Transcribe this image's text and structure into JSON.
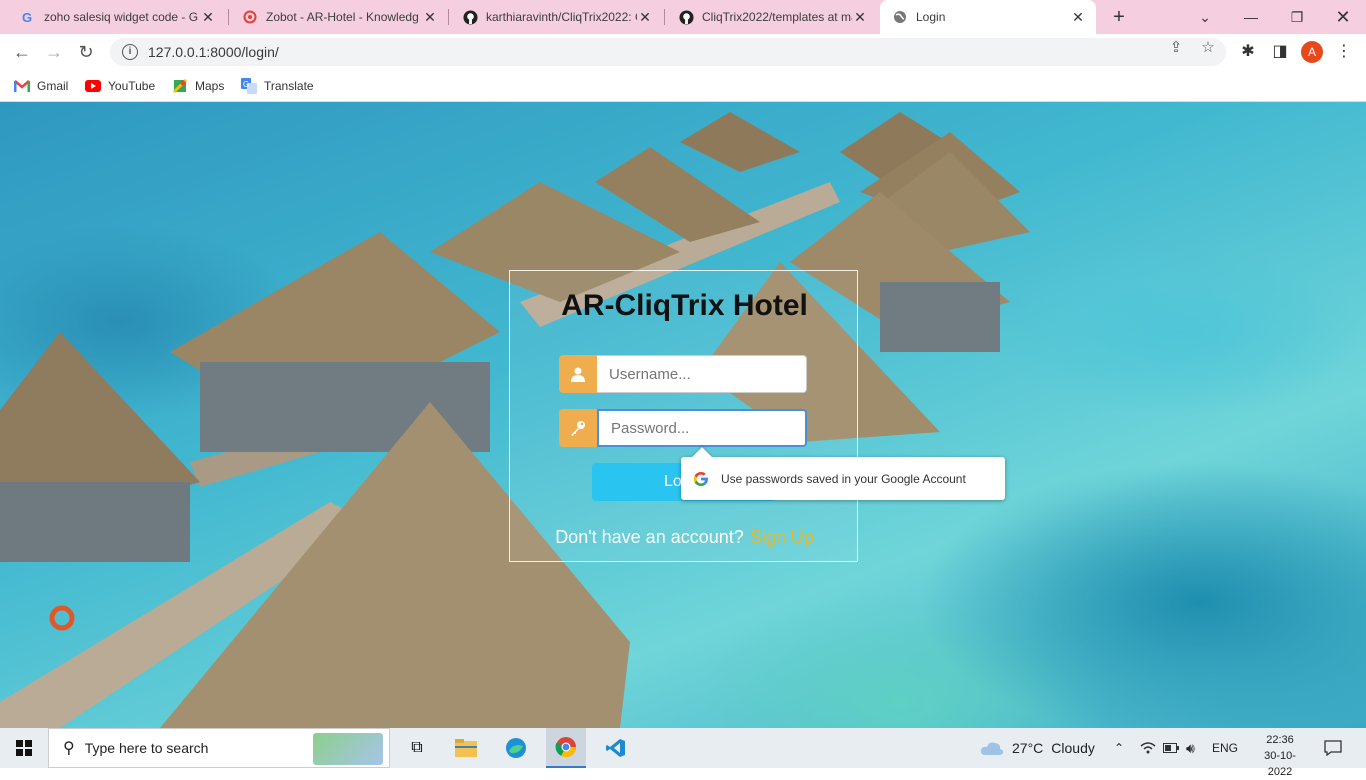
{
  "browser": {
    "tabs": [
      {
        "title": "zoho salesiq widget code - G",
        "favicon": "google-icon"
      },
      {
        "title": "Zobot - AR-Hotel - Knowledg",
        "favicon": "zobot-icon"
      },
      {
        "title": "karthiaravinth/CliqTrix2022: C",
        "favicon": "github-icon"
      },
      {
        "title": "CliqTrix2022/templates at ma",
        "favicon": "github-icon"
      },
      {
        "title": "Login",
        "favicon": "globe-icon",
        "active": true
      }
    ],
    "url": "127.0.0.1:8000/login/",
    "profile_initial": "A",
    "bookmarks": [
      {
        "label": "Gmail",
        "icon": "gmail-icon"
      },
      {
        "label": "YouTube",
        "icon": "youtube-icon"
      },
      {
        "label": "Maps",
        "icon": "maps-icon"
      },
      {
        "label": "Translate",
        "icon": "translate-icon"
      }
    ]
  },
  "login": {
    "title": "AR-CliqTrix Hotel",
    "username_placeholder": "Username...",
    "password_placeholder": "Password...",
    "button_label": "Lo",
    "signup_prompt": "Don't have an account?",
    "signup_link": "Sign Up"
  },
  "password_popup": {
    "text": "Use passwords saved in your Google Account"
  },
  "taskbar": {
    "search_placeholder": "Type here to search",
    "weather_temp": "27°C",
    "weather_desc": "Cloudy",
    "language": "ENG",
    "time": "22:36",
    "date": "30-10-2022"
  },
  "colors": {
    "tabstrip": "#f5cfe0",
    "accent_orange": "#f0ad4e",
    "login_button": "#29c4f0",
    "signup_link": "#f2b51c"
  }
}
